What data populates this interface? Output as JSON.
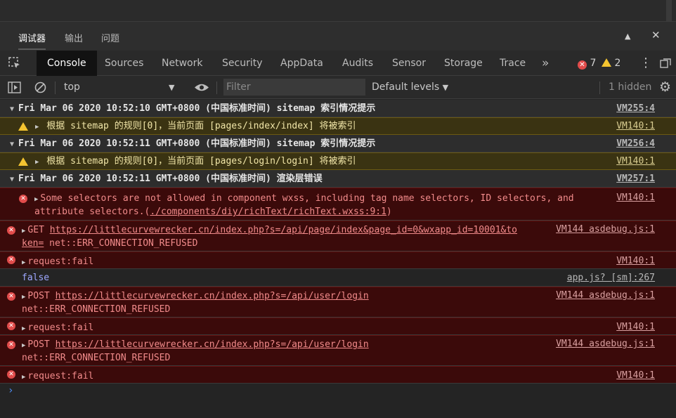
{
  "panel": {
    "tabs": [
      "调试器",
      "输出",
      "问题"
    ],
    "collapse_icon": "▲",
    "close_icon": "✕"
  },
  "devtools": {
    "tabs": [
      "Console",
      "Sources",
      "Network",
      "Security",
      "AppData",
      "Audits",
      "Sensor",
      "Storage",
      "Trace"
    ],
    "more": "»",
    "error_count": "7",
    "warning_count": "2"
  },
  "filterbar": {
    "context": "top",
    "filter_placeholder": "Filter",
    "levels": "Default levels",
    "hidden": "1 hidden"
  },
  "console": {
    "g1_text": "Fri Mar 06 2020 10:52:10 GMT+0800 (中国标准时间) sitemap 索引情况提示",
    "g1_src": "VM255:4",
    "w1_text": "根据 sitemap 的规则[0]，当前页面 [pages/index/index] 将被索引",
    "w1_src": "VM140:1",
    "g2_text": "Fri Mar 06 2020 10:52:11 GMT+0800 (中国标准时间) sitemap 索引情况提示",
    "g2_src": "VM256:4",
    "w2_text": "根据 sitemap 的规则[0]，当前页面 [pages/login/login] 将被索引",
    "w2_src": "VM140:1",
    "g3_text": "Fri Mar 06 2020 10:52:11 GMT+0800 (中国标准时间) 渲染层错误",
    "g3_src": "VM257:1",
    "e1_line1": "Some selectors are not allowed in component wxss, including tag name selectors, ID selectors, and",
    "e1_line2a": "attribute selectors.(",
    "e1_link": "./components/diy/richText/richText.wxss:9:1",
    "e1_line2b": ")",
    "e1_src": "VM140:1",
    "e2_method": "GET ",
    "e2_url1": "https://littlecurvewrecker.cn/index.php?s=/api/page/index&page_id=0&wxapp_id=10001&to",
    "e2_url2": "ken=",
    "e2_err": " net::ERR_CONNECTION_REFUSED",
    "e2_src": "VM144 asdebug.js:1",
    "e3_text": "request:fail",
    "e3_src": "VM140:1",
    "i1_text": "false",
    "i1_src": "app.js? [sm]:267",
    "e4_method": "POST ",
    "e4_url": "https://littlecurvewrecker.cn/index.php?s=/api/user/login",
    "e4_err": "net::ERR_CONNECTION_REFUSED",
    "e4_src": "VM144 asdebug.js:1",
    "e5_text": "request:fail",
    "e5_src": "VM140:1",
    "e6_method": "POST ",
    "e6_url": "https://littlecurvewrecker.cn/index.php?s=/api/user/login",
    "e6_err": "net::ERR_CONNECTION_REFUSED",
    "e6_src": "VM144 asdebug.js:1",
    "e7_text": "request:fail",
    "e7_src": "VM140:1",
    "prompt": "›"
  }
}
